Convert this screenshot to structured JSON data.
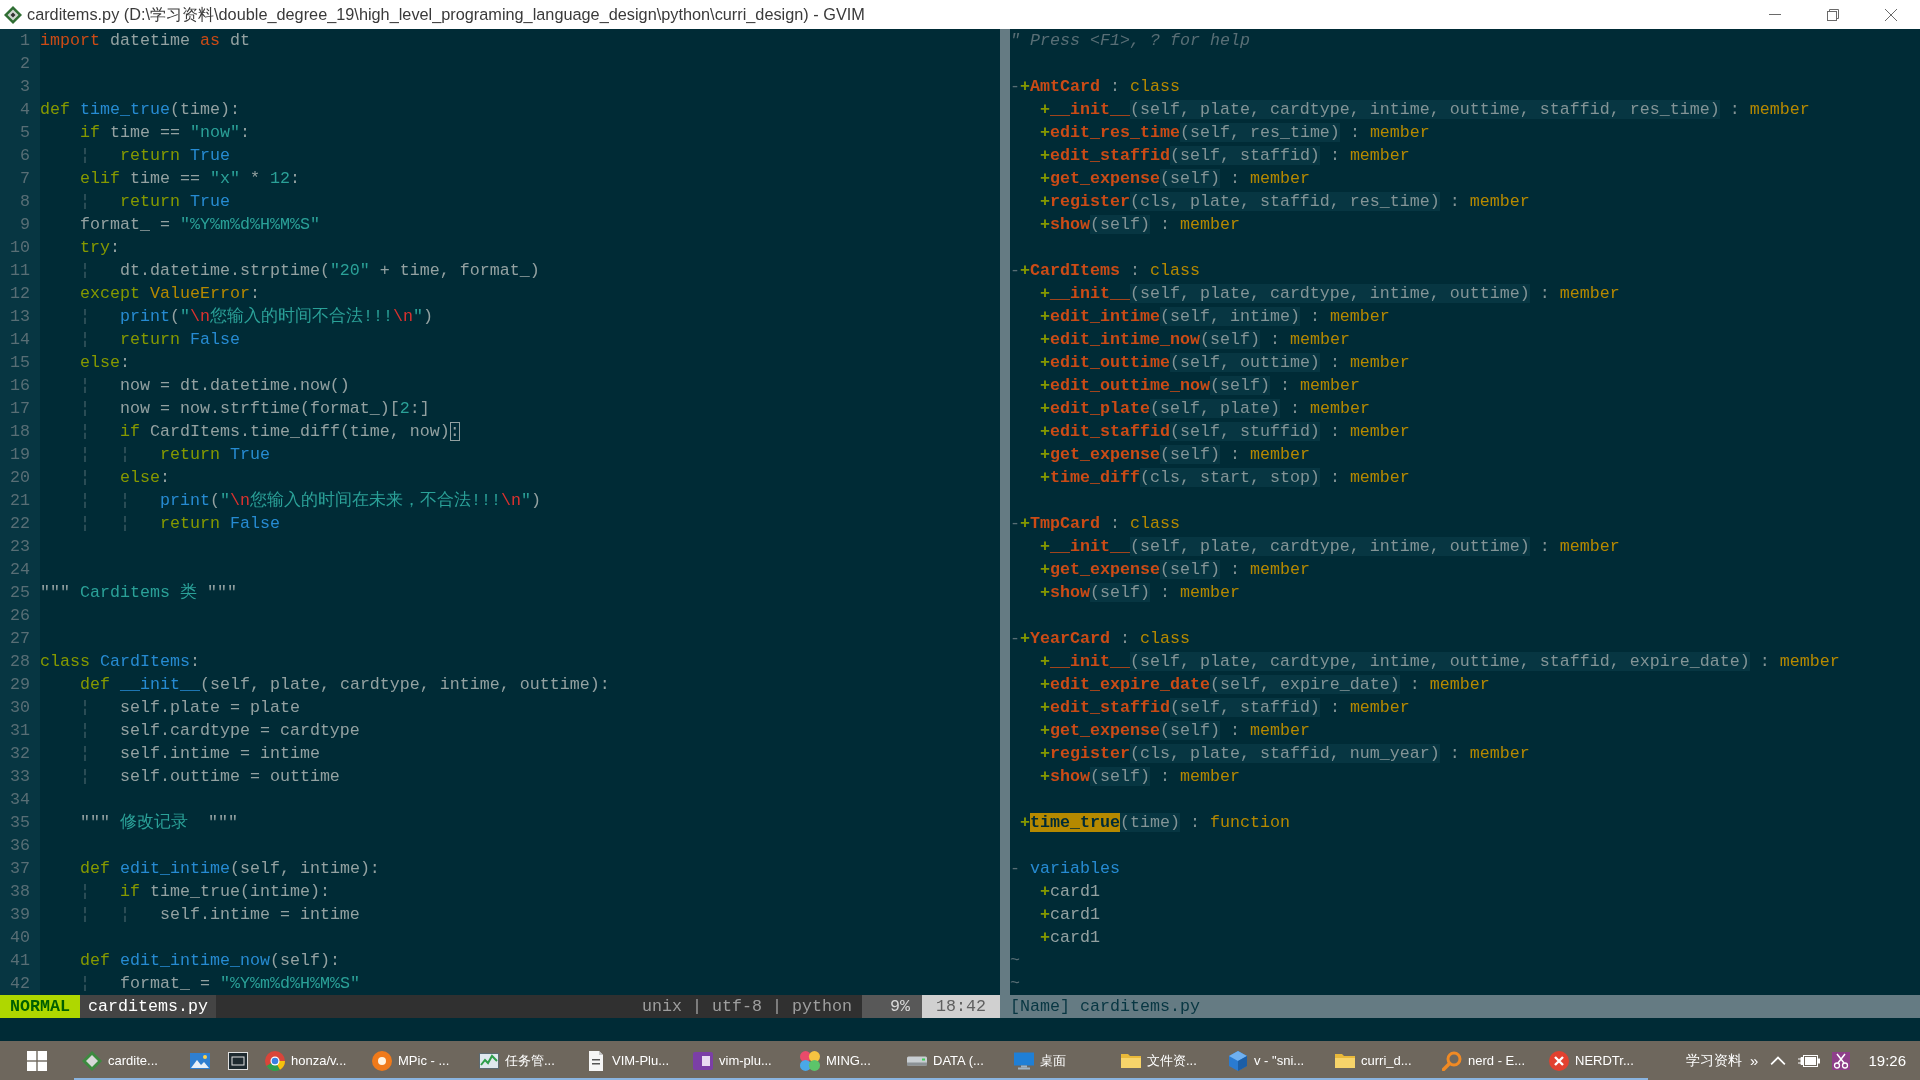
{
  "window": {
    "title": "carditems.py (D:\\学习资料\\double_degree_19\\high_level_programing_language_design\\python\\curri_design) - GVIM"
  },
  "editor": {
    "lines": [
      {
        "number": "1",
        "tokens": [
          {
            "kind": "preproc",
            "text": "import"
          },
          {
            "kind": "plain",
            "text": " datetime "
          },
          {
            "kind": "preproc",
            "text": "as"
          },
          {
            "kind": "plain",
            "text": " dt"
          }
        ]
      },
      {
        "number": "2"
      },
      {
        "number": "3"
      },
      {
        "number": "4",
        "tokens": [
          {
            "kind": "statement",
            "text": "def"
          },
          {
            "kind": "identifier",
            "text": " time_true"
          },
          {
            "kind": "plain",
            "text": "(time):"
          }
        ]
      },
      {
        "number": "5",
        "tokens": [
          {
            "kind": "statement",
            "text": "    if"
          },
          {
            "kind": "plain",
            "text": " time == "
          },
          {
            "kind": "string",
            "text": "\"now\""
          },
          {
            "kind": "plain",
            "text": ":"
          }
        ]
      },
      {
        "number": "6",
        "tokens": [
          {
            "kind": "guide",
            "text": "    ¦"
          },
          {
            "kind": "statement",
            "text": "   return"
          },
          {
            "kind": "identifier",
            "text": " True"
          }
        ]
      },
      {
        "number": "7",
        "tokens": [
          {
            "kind": "statement",
            "text": "    elif"
          },
          {
            "kind": "plain",
            "text": " time == "
          },
          {
            "kind": "string",
            "text": "\"x\""
          },
          {
            "kind": "plain",
            "text": " * "
          },
          {
            "kind": "number",
            "text": "12"
          },
          {
            "kind": "plain",
            "text": ":"
          }
        ]
      },
      {
        "number": "8",
        "tokens": [
          {
            "kind": "guide",
            "text": "    ¦"
          },
          {
            "kind": "statement",
            "text": "   return"
          },
          {
            "kind": "identifier",
            "text": " True"
          }
        ]
      },
      {
        "number": "9",
        "tokens": [
          {
            "kind": "plain",
            "text": "    format_ = "
          },
          {
            "kind": "string",
            "text": "\"%Y%m%d%H%M%S\""
          }
        ]
      },
      {
        "number": "10",
        "tokens": [
          {
            "kind": "statement",
            "text": "    try"
          },
          {
            "kind": "plain",
            "text": ":"
          }
        ]
      },
      {
        "number": "11",
        "tokens": [
          {
            "kind": "guide",
            "text": "    ¦"
          },
          {
            "kind": "plain",
            "text": "   dt.datetime.strptime("
          },
          {
            "kind": "string",
            "text": "\"20\""
          },
          {
            "kind": "plain",
            "text": " + time, format_)"
          }
        ]
      },
      {
        "number": "12",
        "tokens": [
          {
            "kind": "statement",
            "text": "    except"
          },
          {
            "kind": "type",
            "text": " ValueError"
          },
          {
            "kind": "plain",
            "text": ":"
          }
        ]
      },
      {
        "number": "13",
        "tokens": [
          {
            "kind": "guide",
            "text": "    ¦"
          },
          {
            "kind": "identifier",
            "text": "   print"
          },
          {
            "kind": "plain",
            "text": "("
          },
          {
            "kind": "string",
            "text": "\""
          },
          {
            "kind": "special",
            "text": "\\n"
          },
          {
            "kind": "string",
            "text": "您输入的时间不合法!!!"
          },
          {
            "kind": "special",
            "text": "\\n"
          },
          {
            "kind": "string",
            "text": "\""
          },
          {
            "kind": "plain",
            "text": ")"
          }
        ]
      },
      {
        "number": "14",
        "tokens": [
          {
            "kind": "guide",
            "text": "    ¦"
          },
          {
            "kind": "statement",
            "text": "   return"
          },
          {
            "kind": "identifier",
            "text": " False"
          }
        ]
      },
      {
        "number": "15",
        "tokens": [
          {
            "kind": "statement",
            "text": "    else"
          },
          {
            "kind": "plain",
            "text": ":"
          }
        ]
      },
      {
        "number": "16",
        "tokens": [
          {
            "kind": "guide",
            "text": "    ¦"
          },
          {
            "kind": "plain",
            "text": "   now = dt.datetime.now()"
          }
        ]
      },
      {
        "number": "17",
        "tokens": [
          {
            "kind": "guide",
            "text": "    ¦"
          },
          {
            "kind": "plain",
            "text": "   now = now.strftime(format_)["
          },
          {
            "kind": "number",
            "text": "2"
          },
          {
            "kind": "plain",
            "text": ":]"
          }
        ]
      },
      {
        "number": "18",
        "tokens": [
          {
            "kind": "guide",
            "text": "    ¦"
          },
          {
            "kind": "statement",
            "text": "   if"
          },
          {
            "kind": "plain",
            "text": " CardItems.time_diff(time, now)"
          },
          {
            "kind": "cursor",
            "text": ":"
          }
        ]
      },
      {
        "number": "19",
        "tokens": [
          {
            "kind": "guide",
            "text": "    ¦   ¦"
          },
          {
            "kind": "statement",
            "text": "   return"
          },
          {
            "kind": "identifier",
            "text": " True"
          }
        ]
      },
      {
        "number": "20",
        "tokens": [
          {
            "kind": "guide",
            "text": "    ¦"
          },
          {
            "kind": "statement",
            "text": "   else"
          },
          {
            "kind": "plain",
            "text": ":"
          }
        ]
      },
      {
        "number": "21",
        "tokens": [
          {
            "kind": "guide",
            "text": "    ¦   ¦"
          },
          {
            "kind": "identifier",
            "text": "   print"
          },
          {
            "kind": "plain",
            "text": "("
          },
          {
            "kind": "string",
            "text": "\""
          },
          {
            "kind": "special",
            "text": "\\n"
          },
          {
            "kind": "string",
            "text": "您输入的时间在未来，不合法!!!"
          },
          {
            "kind": "special",
            "text": "\\n"
          },
          {
            "kind": "string",
            "text": "\""
          },
          {
            "kind": "plain",
            "text": ")"
          }
        ]
      },
      {
        "number": "22",
        "tokens": [
          {
            "kind": "guide",
            "text": "    ¦   ¦"
          },
          {
            "kind": "statement",
            "text": "   return"
          },
          {
            "kind": "identifier",
            "text": " False"
          }
        ]
      },
      {
        "number": "23"
      },
      {
        "number": "24"
      },
      {
        "number": "25",
        "tokens": [
          {
            "kind": "plain",
            "text": "\"\"\""
          },
          {
            "kind": "string",
            "text": " Carditems 类 "
          },
          {
            "kind": "plain",
            "text": "\"\"\""
          }
        ]
      },
      {
        "number": "26"
      },
      {
        "number": "27"
      },
      {
        "number": "28",
        "tokens": [
          {
            "kind": "statement",
            "text": "class"
          },
          {
            "kind": "identifier",
            "text": " CardItems"
          },
          {
            "kind": "plain",
            "text": ":"
          }
        ]
      },
      {
        "number": "29",
        "tokens": [
          {
            "kind": "statement",
            "text": "    def"
          },
          {
            "kind": "identifier",
            "text": " __init__"
          },
          {
            "kind": "plain",
            "text": "(self, plate, cardtype, intime, outtime):"
          }
        ]
      },
      {
        "number": "30",
        "tokens": [
          {
            "kind": "guide",
            "text": "    ¦"
          },
          {
            "kind": "plain",
            "text": "   self.plate = plate"
          }
        ]
      },
      {
        "number": "31",
        "tokens": [
          {
            "kind": "guide",
            "text": "    ¦"
          },
          {
            "kind": "plain",
            "text": "   self.cardtype = cardtype"
          }
        ]
      },
      {
        "number": "32",
        "tokens": [
          {
            "kind": "guide",
            "text": "    ¦"
          },
          {
            "kind": "plain",
            "text": "   self.intime = intime"
          }
        ]
      },
      {
        "number": "33",
        "tokens": [
          {
            "kind": "guide",
            "text": "    ¦"
          },
          {
            "kind": "plain",
            "text": "   self.outtime = outtime"
          }
        ]
      },
      {
        "number": "34"
      },
      {
        "number": "35",
        "tokens": [
          {
            "kind": "plain",
            "text": "    \"\"\""
          },
          {
            "kind": "string",
            "text": " 修改记录  "
          },
          {
            "kind": "plain",
            "text": "\"\"\""
          }
        ]
      },
      {
        "number": "36"
      },
      {
        "number": "37",
        "tokens": [
          {
            "kind": "statement",
            "text": "    def"
          },
          {
            "kind": "identifier",
            "text": " edit_intime"
          },
          {
            "kind": "plain",
            "text": "(self, intime):"
          }
        ]
      },
      {
        "number": "38",
        "tokens": [
          {
            "kind": "guide",
            "text": "    ¦"
          },
          {
            "kind": "statement",
            "text": "   if"
          },
          {
            "kind": "plain",
            "text": " time_true(intime):"
          }
        ]
      },
      {
        "number": "39",
        "tokens": [
          {
            "kind": "guide",
            "text": "    ¦   ¦"
          },
          {
            "kind": "plain",
            "text": "   self.intime = intime"
          }
        ]
      },
      {
        "number": "40"
      },
      {
        "number": "41",
        "tokens": [
          {
            "kind": "statement",
            "text": "    def"
          },
          {
            "kind": "identifier",
            "text": " edit_intime_now"
          },
          {
            "kind": "plain",
            "text": "(self):"
          }
        ]
      },
      {
        "number": "42",
        "tokens": [
          {
            "kind": "guide",
            "text": "    ¦"
          },
          {
            "kind": "plain",
            "text": "   format_ = "
          },
          {
            "kind": "string",
            "text": "\"%Y%m%d%H%M%S\""
          }
        ]
      }
    ]
  },
  "tagbar": {
    "help": "\" Press <F1>, ? for help",
    "separator": ":",
    "tags": [
      {
        "kind": "tag",
        "fold": "-",
        "marker": "+",
        "name": "AmtCard",
        "type": "class",
        "selected": false,
        "children": [
          {
            "kind": "tag",
            "marker": "+",
            "name": "__init__",
            "signature": "(self, plate, cardtype, intime, outtime, staffid, res_time)",
            "type": "member",
            "selected": false
          },
          {
            "kind": "tag",
            "marker": "+",
            "name": "edit_res_time",
            "signature": "(self, res_time)",
            "type": "member",
            "selected": false
          },
          {
            "kind": "tag",
            "marker": "+",
            "name": "edit_staffid",
            "signature": "(self, staffid)",
            "type": "member",
            "selected": false
          },
          {
            "kind": "tag",
            "marker": "+",
            "name": "get_expense",
            "signature": "(self)",
            "type": "member",
            "selected": false
          },
          {
            "kind": "tag",
            "marker": "+",
            "name": "register",
            "signature": "(cls, plate, staffid, res_time)",
            "type": "member",
            "selected": false
          },
          {
            "kind": "tag",
            "marker": "+",
            "name": "show",
            "signature": "(self)",
            "type": "member",
            "selected": false
          }
        ]
      },
      {
        "kind": "tag",
        "fold": "-",
        "marker": "+",
        "name": "CardItems",
        "type": "class",
        "selected": false,
        "children": [
          {
            "kind": "tag",
            "marker": "+",
            "name": "__init__",
            "signature": "(self, plate, cardtype, intime, outtime)",
            "type": "member",
            "selected": false
          },
          {
            "kind": "tag",
            "marker": "+",
            "name": "edit_intime",
            "signature": "(self, intime)",
            "type": "member",
            "selected": false
          },
          {
            "kind": "tag",
            "marker": "+",
            "name": "edit_intime_now",
            "signature": "(self)",
            "type": "member",
            "selected": false
          },
          {
            "kind": "tag",
            "marker": "+",
            "name": "edit_outtime",
            "signature": "(self, outtime)",
            "type": "member",
            "selected": false
          },
          {
            "kind": "tag",
            "marker": "+",
            "name": "edit_outtime_now",
            "signature": "(self)",
            "type": "member",
            "selected": false
          },
          {
            "kind": "tag",
            "marker": "+",
            "name": "edit_plate",
            "signature": "(self, plate)",
            "type": "member",
            "selected": false
          },
          {
            "kind": "tag",
            "marker": "+",
            "name": "edit_staffid",
            "signature": "(self, stuffid)",
            "type": "member",
            "selected": false
          },
          {
            "kind": "tag",
            "marker": "+",
            "name": "get_expense",
            "signature": "(self)",
            "type": "member",
            "selected": false
          },
          {
            "kind": "tag",
            "marker": "+",
            "name": "time_diff",
            "signature": "(cls, start, stop)",
            "type": "member",
            "selected": false
          }
        ]
      },
      {
        "kind": "tag",
        "fold": "-",
        "marker": "+",
        "name": "TmpCard",
        "type": "class",
        "selected": false,
        "children": [
          {
            "kind": "tag",
            "marker": "+",
            "name": "__init__",
            "signature": "(self, plate, cardtype, intime, outtime)",
            "type": "member",
            "selected": false
          },
          {
            "kind": "tag",
            "marker": "+",
            "name": "get_expense",
            "signature": "(self)",
            "type": "member",
            "selected": false
          },
          {
            "kind": "tag",
            "marker": "+",
            "name": "show",
            "signature": "(self)",
            "type": "member",
            "selected": false
          }
        ]
      },
      {
        "kind": "tag",
        "fold": "-",
        "marker": "+",
        "name": "YearCard",
        "type": "class",
        "selected": false,
        "children": [
          {
            "kind": "tag",
            "marker": "+",
            "name": "__init__",
            "signature": "(self, plate, cardtype, intime, outtime, staffid, expire_date)",
            "type": "member",
            "selected": false
          },
          {
            "kind": "tag",
            "marker": "+",
            "name": "edit_expire_date",
            "signature": "(self, expire_date)",
            "type": "member",
            "selected": false
          },
          {
            "kind": "tag",
            "marker": "+",
            "name": "edit_staffid",
            "signature": "(self, staffid)",
            "type": "member",
            "selected": false
          },
          {
            "kind": "tag",
            "marker": "+",
            "name": "get_expense",
            "signature": "(self)",
            "type": "member",
            "selected": false
          },
          {
            "kind": "tag",
            "marker": "+",
            "name": "register",
            "signature": "(cls, plate, staffid, num_year)",
            "type": "member",
            "selected": false
          },
          {
            "kind": "tag",
            "marker": "+",
            "name": "show",
            "signature": "(self)",
            "type": "member",
            "selected": false
          }
        ]
      },
      {
        "kind": "tag",
        "marker": "+",
        "name": "time_true",
        "signature": "(time)",
        "type": "function",
        "selected": true
      },
      {
        "kind": "heading",
        "fold": "-",
        "name": "variables",
        "selected": false,
        "children": [
          {
            "kind": "variable",
            "marker": "+",
            "name": "card1",
            "selected": false
          },
          {
            "kind": "variable",
            "marker": "+",
            "name": "card1",
            "selected": false
          },
          {
            "kind": "variable",
            "marker": "+",
            "name": "card1",
            "selected": false
          }
        ]
      }
    ],
    "filler": [
      "~",
      "~"
    ]
  },
  "statusline": {
    "mode": "NORMAL",
    "file": "carditems.py",
    "fileinfo": "unix | utf-8 | python",
    "percent": "9%",
    "position": "18:42"
  },
  "tagbar_status": "[Name] carditems.py",
  "taskbar": {
    "tasks": [
      {
        "kind": "diamond",
        "label": "cardite..."
      },
      {
        "kind": "picture"
      },
      {
        "kind": "window"
      },
      {
        "kind": "circle",
        "label": "honza/v..."
      },
      {
        "kind": "disc",
        "label": "MPic - ..."
      },
      {
        "kind": "chart",
        "label": "任务管..."
      },
      {
        "kind": "document",
        "label": "VIM-Plu..."
      },
      {
        "kind": "tile",
        "label": "vim-plu..."
      },
      {
        "kind": "pinwheel",
        "label": "MING..."
      },
      {
        "kind": "drive",
        "label": "DATA (..."
      },
      {
        "kind": "monitor",
        "label": "桌面"
      },
      {
        "kind": "folder",
        "label": "文件资..."
      },
      {
        "kind": "cube",
        "label": "v - \"sni..."
      },
      {
        "kind": "folder",
        "label": "curri_d..."
      },
      {
        "kind": "search",
        "label": "nerd - E..."
      },
      {
        "kind": "cross",
        "label": "NERDTr..."
      }
    ],
    "toolbar": "学习资料",
    "toolbar_overflow": "»",
    "clock": "19:26"
  }
}
